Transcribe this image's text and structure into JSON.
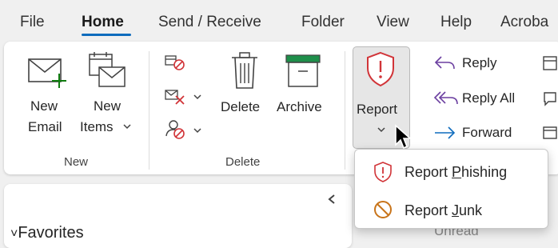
{
  "tabs": [
    {
      "label": "File"
    },
    {
      "label": "Home"
    },
    {
      "label": "Send / Receive"
    },
    {
      "label": "Folder"
    },
    {
      "label": "View"
    },
    {
      "label": "Help"
    },
    {
      "label": "Acroba"
    }
  ],
  "ribbon": {
    "new_group": {
      "label": "New",
      "new_email": [
        "New",
        "Email"
      ],
      "new_items": [
        "New",
        "Items"
      ]
    },
    "delete_group": {
      "label": "Delete",
      "delete": "Delete",
      "archive": "Archive"
    },
    "report": {
      "label": "Report"
    },
    "respond": {
      "reply": "Reply",
      "reply_all": "Reply All",
      "forward": "Forward"
    }
  },
  "report_menu": {
    "phishing": {
      "pre": "Report ",
      "underlined": "P",
      "post": "hishing"
    },
    "junk": {
      "pre": "Report ",
      "underlined": "J",
      "post": "unk"
    }
  },
  "lower": {
    "favorites": "Favorites",
    "unread_partial": "Unread"
  },
  "colors": {
    "accent": "#0f6cbd",
    "report_red": "#d13438",
    "junk_orange": "#c8741a",
    "new_green": "#107c10",
    "archive_green": "#1e8f4a",
    "reply_purple": "#6b3fa0"
  }
}
